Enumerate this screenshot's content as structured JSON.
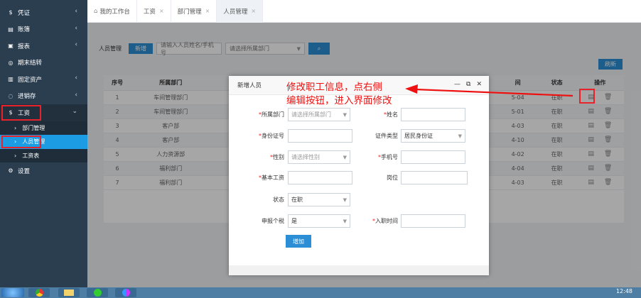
{
  "sidebar": {
    "items": [
      {
        "label": "凭证",
        "icon": "dollar-icon",
        "glyph": "$",
        "has_chevron": true
      },
      {
        "label": "账簿",
        "icon": "book-icon",
        "glyph": "▤",
        "has_chevron": true
      },
      {
        "label": "报表",
        "icon": "report-icon",
        "glyph": "▣",
        "has_chevron": true
      },
      {
        "label": "期末结转",
        "icon": "transfer-icon",
        "glyph": "◎",
        "has_chevron": false
      },
      {
        "label": "固定资产",
        "icon": "asset-icon",
        "glyph": "▥",
        "has_chevron": true
      },
      {
        "label": "进销存",
        "icon": "inventory-icon",
        "glyph": "◌",
        "has_chevron": true
      },
      {
        "label": "工资",
        "icon": "salary-icon",
        "glyph": "$",
        "has_chevron": true
      }
    ],
    "salary_sub": [
      {
        "label": "部门管理"
      },
      {
        "label": "人员管理",
        "active": true
      },
      {
        "label": "工资表"
      }
    ],
    "settings": {
      "label": "设置",
      "glyph": "⚙"
    }
  },
  "tabs": [
    {
      "label": "我的工作台",
      "home": true,
      "closable": false
    },
    {
      "label": "工资",
      "closable": true
    },
    {
      "label": "部门管理",
      "closable": true
    },
    {
      "label": "人员管理",
      "closable": true,
      "active": true
    }
  ],
  "toolbar": {
    "title": "人员管理",
    "new_label": "新增",
    "search_placeholder": "请输入人员姓名/手机号",
    "dept_placeholder": "请选择所属部门",
    "refresh_label": "刷新"
  },
  "table": {
    "headers": [
      "序号",
      "所属部门",
      "",
      "",
      "",
      "",
      "",
      "",
      "间",
      "状态",
      "操作"
    ],
    "rows": [
      {
        "no": "1",
        "dept": "车间管理部门",
        "date": "5-04",
        "status": "在职"
      },
      {
        "no": "2",
        "dept": "车间管理部门",
        "date": "5-01",
        "status": "在职"
      },
      {
        "no": "3",
        "dept": "客户部",
        "date": "4-03",
        "status": "在职"
      },
      {
        "no": "4",
        "dept": "客户部",
        "date": "4-10",
        "status": "在职"
      },
      {
        "no": "5",
        "dept": "人力资源部",
        "date": "4-02",
        "status": "在职"
      },
      {
        "no": "6",
        "dept": "福利部门",
        "date": "4-04",
        "status": "在职"
      },
      {
        "no": "7",
        "dept": "福利部门",
        "date": "4-03",
        "status": "在职"
      }
    ]
  },
  "modal": {
    "title": "新增人员",
    "fields": {
      "dept_label": "所属部门",
      "dept_placeholder": "请选择所属部门",
      "name_label": "姓名",
      "id_label": "身份证号",
      "cert_type_label": "证件类型",
      "cert_type_value": "居民身份证",
      "gender_label": "性别",
      "gender_placeholder": "请选择性别",
      "phone_label": "手机号",
      "salary_label": "基本工资",
      "position_label": "岗位",
      "status_label": "状态",
      "status_value": "在职",
      "tax_label": "申报个税",
      "tax_value": "是",
      "join_label": "入职时间"
    },
    "add_label": "增加"
  },
  "annotation": {
    "line1": "修改职工信息，点右侧",
    "line2": "编辑按钮，进入界面修改",
    "color": "#e11111"
  },
  "taskbar": {
    "time": "12:48"
  }
}
